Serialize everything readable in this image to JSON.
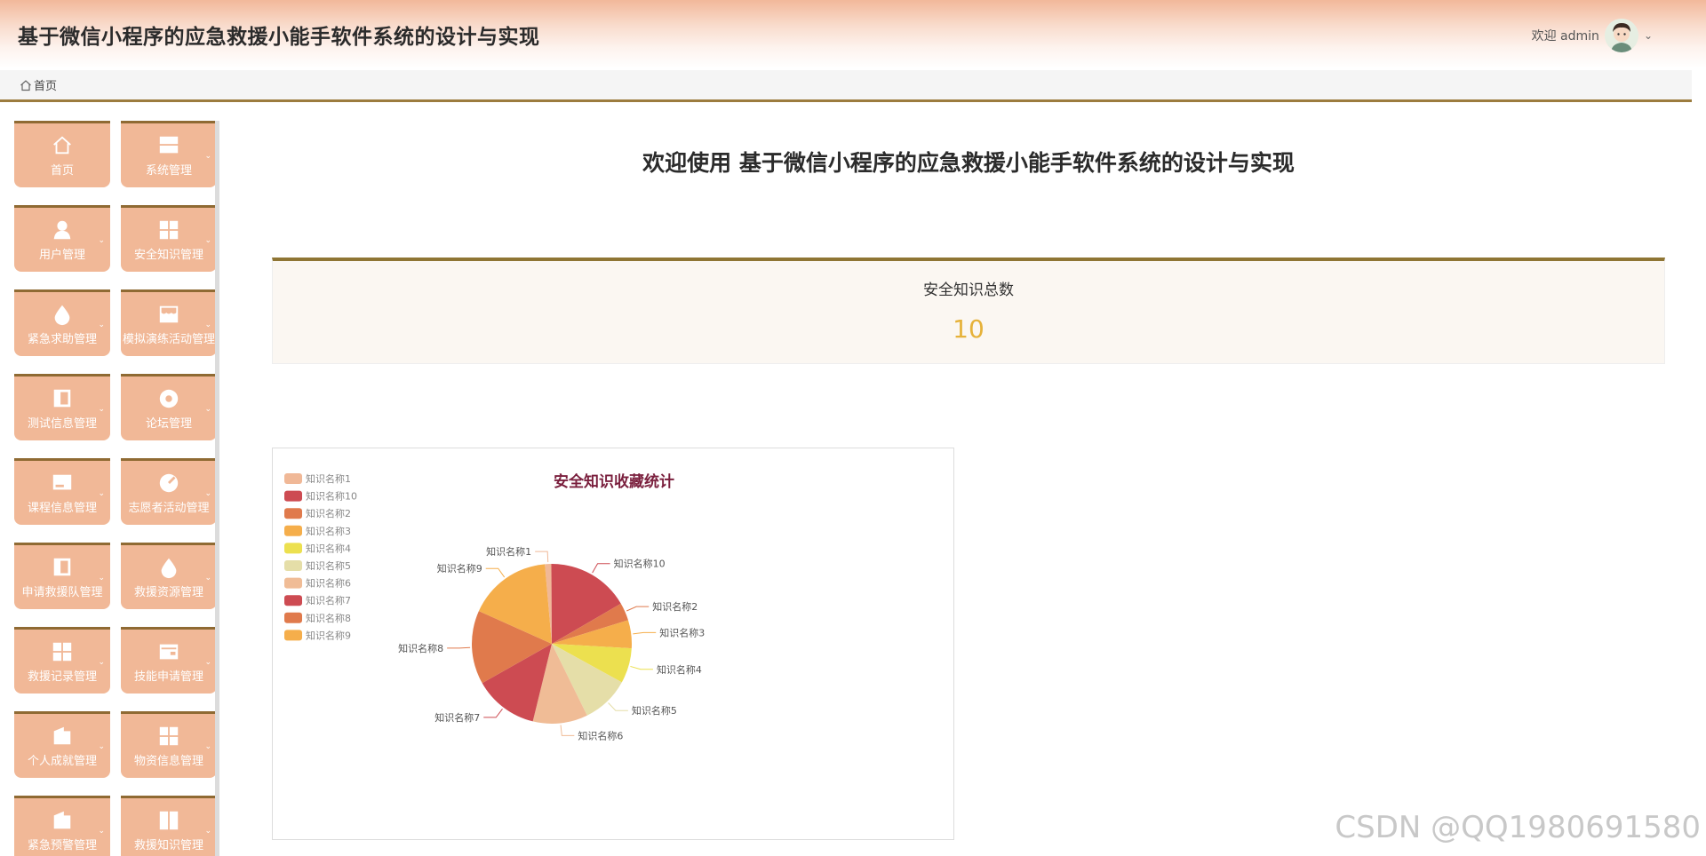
{
  "header": {
    "title": "基于微信小程序的应急救援小能手软件系统的设计与实现",
    "welcome": "欢迎 admin",
    "avatar_icon": "user-avatar-icon"
  },
  "breadcrumb": {
    "home_icon": "home-icon",
    "label": "首页"
  },
  "sidebar": {
    "items": [
      {
        "label": "首页",
        "icon": "home-icon",
        "has_arrow": false
      },
      {
        "label": "系统管理",
        "icon": "layout-icon",
        "has_arrow": true
      },
      {
        "label": "用户管理",
        "icon": "user-icon",
        "has_arrow": true
      },
      {
        "label": "安全知识管理",
        "icon": "grid-icon",
        "has_arrow": true
      },
      {
        "label": "紧急求助管理",
        "icon": "drop-icon",
        "has_arrow": true
      },
      {
        "label": "模拟演练活动管理",
        "icon": "shop-icon",
        "has_arrow": true
      },
      {
        "label": "测试信息管理",
        "icon": "book-icon",
        "has_arrow": true
      },
      {
        "label": "论坛管理",
        "icon": "disc-icon",
        "has_arrow": true
      },
      {
        "label": "课程信息管理",
        "icon": "monitor-icon",
        "has_arrow": true
      },
      {
        "label": "志愿者活动管理",
        "icon": "dashboard-icon",
        "has_arrow": true
      },
      {
        "label": "申请救援队管理",
        "icon": "book-icon",
        "has_arrow": true
      },
      {
        "label": "救援资源管理",
        "icon": "drop-icon",
        "has_arrow": true
      },
      {
        "label": "救援记录管理",
        "icon": "grid-icon",
        "has_arrow": true
      },
      {
        "label": "技能申请管理",
        "icon": "wallet-icon",
        "has_arrow": true
      },
      {
        "label": "个人成就管理",
        "icon": "folder-icon",
        "has_arrow": true
      },
      {
        "label": "物资信息管理",
        "icon": "grid-icon",
        "has_arrow": true
      },
      {
        "label": "紧急预警管理",
        "icon": "folder-icon",
        "has_arrow": true
      },
      {
        "label": "救援知识管理",
        "icon": "columns-icon",
        "has_arrow": true
      }
    ]
  },
  "main": {
    "welcome_title": "欢迎使用 基于微信小程序的应急救援小能手软件系统的设计与实现",
    "stat": {
      "label": "安全知识总数",
      "value": "10"
    }
  },
  "colors": {
    "accent": "#8f7534",
    "tile": "#f1b897",
    "stat_value": "#e6b23a",
    "chart_title": "#7a1f3d"
  },
  "watermark": "CSDN @QQ1980691580",
  "chart_data": {
    "type": "pie",
    "title": "安全知识收藏统计",
    "legend_position": "top-left",
    "slices": [
      {
        "name": "知识名称1",
        "value": 1.3,
        "color": "#f0b897"
      },
      {
        "name": "知识名称10",
        "value": 16.7,
        "color": "#cd4b52"
      },
      {
        "name": "知识名称2",
        "value": 3.6,
        "color": "#e07a4c"
      },
      {
        "name": "知识名称3",
        "value": 5.7,
        "color": "#f5ae4b"
      },
      {
        "name": "知识名称4",
        "value": 7.1,
        "color": "#ece04f"
      },
      {
        "name": "知识名称5",
        "value": 9.7,
        "color": "#e5dea8"
      },
      {
        "name": "知识名称6",
        "value": 11.1,
        "color": "#f0bc96"
      },
      {
        "name": "知识名称7",
        "value": 13.0,
        "color": "#cd4b52"
      },
      {
        "name": "知识名称8",
        "value": 14.9,
        "color": "#e07a4c"
      },
      {
        "name": "知识名称9",
        "value": 16.9,
        "color": "#f5ae4b"
      }
    ]
  }
}
